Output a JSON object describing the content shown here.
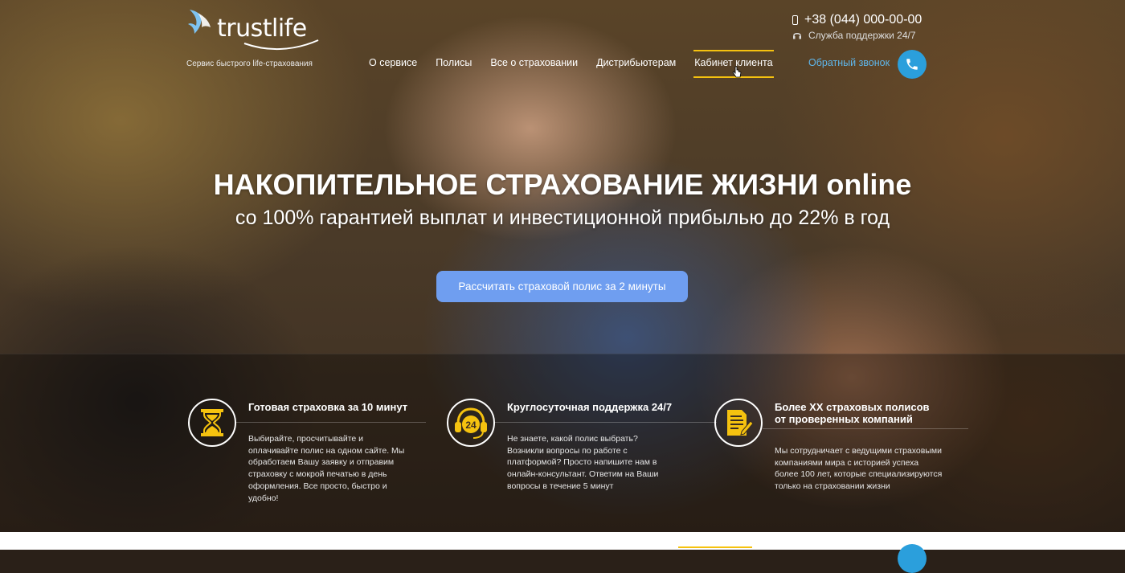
{
  "header": {
    "logo_text": "trustlife",
    "tagline": "Сервис быстрого life-страхования",
    "nav": [
      {
        "label": "О сервисе"
      },
      {
        "label": "Полисы"
      },
      {
        "label": "Все о страховании"
      },
      {
        "label": "Дистрибьютерам"
      },
      {
        "label": "Кабинет клиента"
      }
    ],
    "phone": "+38 (044) 000-00-00",
    "support": "Служба поддержки 24/7",
    "callback": "Обратный звонок"
  },
  "hero": {
    "title": "НАКОПИТЕЛЬНОЕ СТРАХОВАНИЕ ЖИЗНИ online",
    "subtitle": "со 100% гарантией выплат и инвестиционной прибылью до 22% в год",
    "cta": "Рассчитать страховой полис за 2 минуты"
  },
  "features": [
    {
      "title": "Готовая страховка за 10 минут",
      "text": "Выбирайте, просчитывайте и оплачивайте полис на одном сайте. Мы обработаем Вашу заявку и отправим страховку с мокрой печатью в день оформления. Все просто, быстро и удобно!",
      "icon": "hourglass-icon"
    },
    {
      "title": "Круглосуточная поддержка 24/7",
      "text": "Не знаете, какой полис выбрать? Возникли вопросы по работе с платформой? Просто напишите нам в онлайн-консультант. Ответим на Ваши вопросы в течение 5 минут",
      "icon": "headset-24-icon",
      "badge": "24"
    },
    {
      "title_line1": "Более XX страховых полисов",
      "title_line2": "от проверенных компаний",
      "text": "Мы сотрудничает с ведущими страховыми компаниями мира с историей успеха более 100 лет, которые специализируются только на страховании жизни",
      "icon": "document-pen-icon"
    }
  ],
  "colors": {
    "accent_yellow": "#f5c20f",
    "link_blue": "#5fb6ea",
    "call_blue": "#2b9fdc",
    "cta_blue": "#6f9ef0"
  }
}
